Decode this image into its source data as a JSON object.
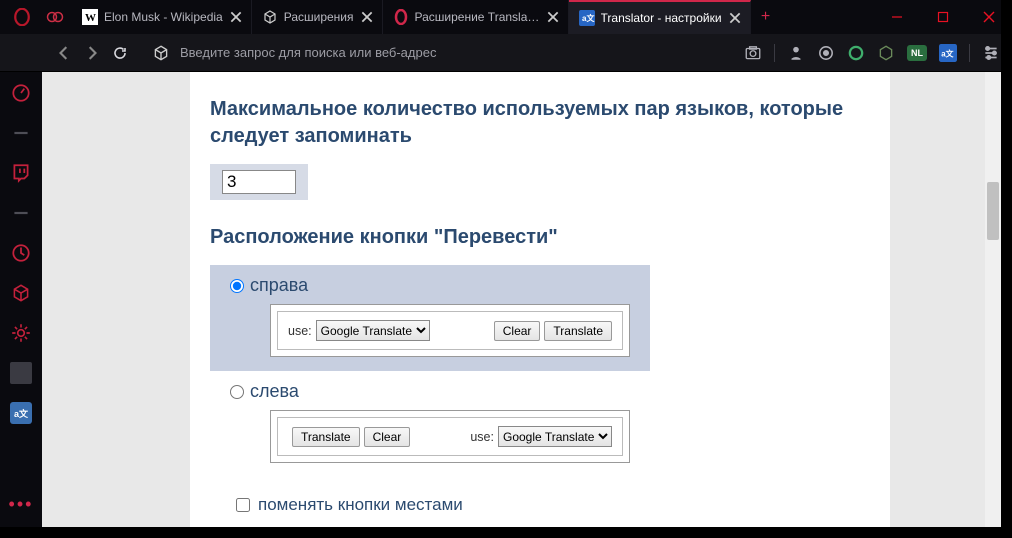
{
  "tabs": [
    {
      "label": "Elon Musk - Wikipedia"
    },
    {
      "label": "Расширения"
    },
    {
      "label": "Расширение Translator"
    },
    {
      "label": "Translator - настройки"
    }
  ],
  "addr_placeholder": "Введите запрос для поиска или веб-адрес",
  "badge_text": "NL",
  "page": {
    "heading1": "Максимальное количество используемых пар языков, которые следует запоминать",
    "input_value": "3",
    "heading2": "Расположение кнопки \"Перевести\"",
    "opt_right": "справа",
    "opt_left": "слева",
    "use_label": "use:",
    "select_value": "Google Translate",
    "btn_clear": "Clear",
    "btn_translate": "Translate",
    "swap_label": "поменять кнопки местами"
  }
}
